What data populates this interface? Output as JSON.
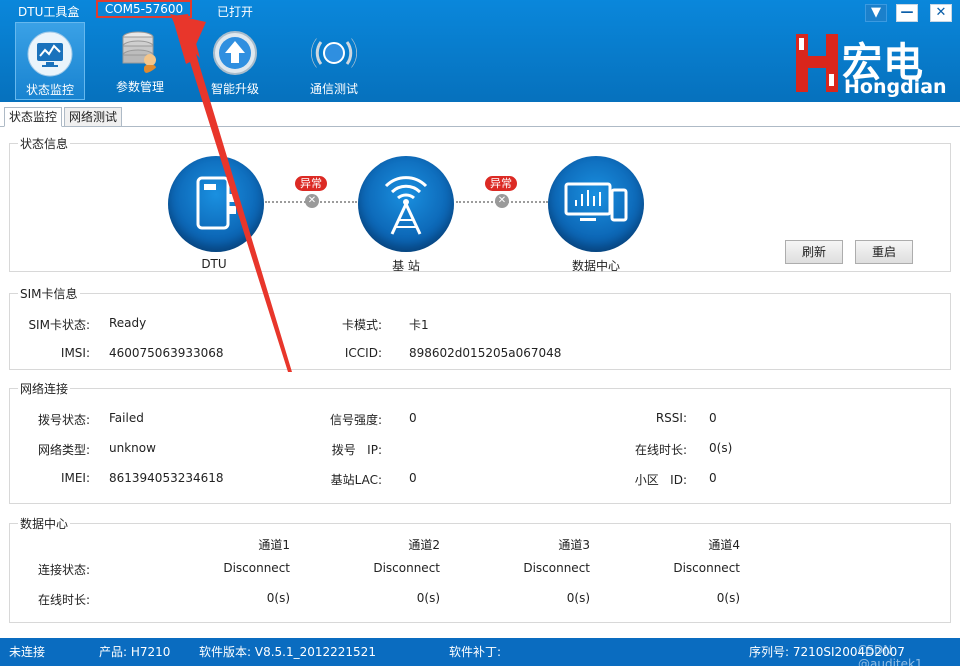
{
  "titlebar": {
    "app_title": "DTU工具盒",
    "com_port": "COM5-57600",
    "port_status": "已打开",
    "menu_btn": "▼",
    "min_btn": "—",
    "close_btn": "✕"
  },
  "toolbar": [
    {
      "label": "状态监控",
      "icon": "monitor-icon"
    },
    {
      "label": "参数管理",
      "icon": "database-icon"
    },
    {
      "label": "智能升级",
      "icon": "upgrade-icon"
    },
    {
      "label": "通信测试",
      "icon": "signal-test-icon"
    }
  ],
  "logo": {
    "cn": "宏电",
    "en": "Hongdian"
  },
  "tabs": [
    "状态监控",
    "网络测试"
  ],
  "status_info": {
    "title": "状态信息",
    "nodes": [
      "DTU",
      "基  站",
      "数据中心"
    ],
    "link_badge": "异常",
    "refresh": "刷新",
    "restart": "重启"
  },
  "sim": {
    "title": "SIM卡信息",
    "sim_status_label": "SIM卡状态:",
    "sim_status": "Ready",
    "card_mode_label": "卡模式:",
    "card_mode": "卡1",
    "imsi_label": "IMSI:",
    "imsi": "460075063933068",
    "iccid_label": "ICCID:",
    "iccid": "898602d015205a067048"
  },
  "network": {
    "title": "网络连接",
    "dial_status_label": "拨号状态:",
    "dial_status": "Failed",
    "signal_label": "信号强度:",
    "signal": "0",
    "rssi_label": "RSSI:",
    "rssi": "0",
    "net_type_label": "网络类型:",
    "net_type": "unknow",
    "dial_ip_label": "拨号   IP:",
    "dial_ip": "",
    "online_label": "在线时长:",
    "online": "0(s)",
    "imei_label": "IMEI:",
    "imei": "861394053234618",
    "lac_label": "基站LAC:",
    "lac": "0",
    "cell_label": "小区   ID:",
    "cell": "0"
  },
  "datacenter": {
    "title": "数据中心",
    "conn_label": "连接状态:",
    "online_label": "在线时长:",
    "channels": [
      {
        "name": "通道1",
        "status": "Disconnect",
        "online": "0(s)"
      },
      {
        "name": "通道2",
        "status": "Disconnect",
        "online": "0(s)"
      },
      {
        "name": "通道3",
        "status": "Disconnect",
        "online": "0(s)"
      },
      {
        "name": "通道4",
        "status": "Disconnect",
        "online": "0(s)"
      }
    ]
  },
  "statusbar": {
    "conn": "未连接",
    "product": "产品: H7210",
    "version": "软件版本: V8.5.1_2012221521",
    "patch": "软件补丁:",
    "serial": "序列号: 7210SI2004D2007",
    "watermark": "CSDN @auditek1"
  },
  "colors": {
    "header_blue": "#0a7fd1",
    "status_bar_blue": "#0a6cc0",
    "alert_red": "#dc2a24",
    "annotation_red": "#e23b2e"
  }
}
